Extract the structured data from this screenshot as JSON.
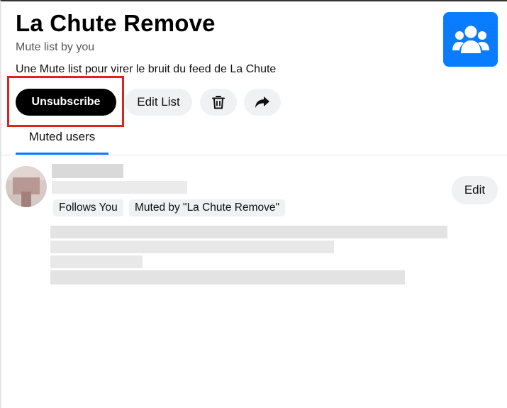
{
  "list": {
    "title": "La Chute Remove",
    "subtitle": "Mute list by you",
    "description": "Une Mute list pour virer le bruit du feed de La Chute",
    "avatar_icon": "people-group-icon",
    "accent_color": "#0a7cff"
  },
  "actions": {
    "unsubscribe_label": "Unsubscribe",
    "edit_list_label": "Edit List",
    "delete_icon": "trash-icon",
    "share_icon": "share-forward-icon"
  },
  "tabs": [
    {
      "label": "Muted users",
      "active": true
    }
  ],
  "members": [
    {
      "badges": [
        "Follows You",
        "Muted by \"La Chute Remove\""
      ],
      "edit_label": "Edit"
    }
  ],
  "highlight_color": "#e0211d"
}
